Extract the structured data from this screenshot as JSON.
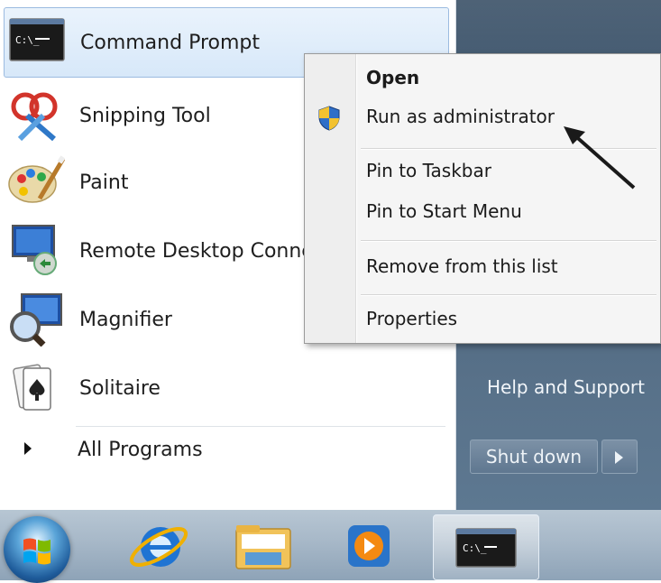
{
  "start_menu": {
    "programs": [
      {
        "label": "Command Prompt",
        "icon": "command-prompt-icon"
      },
      {
        "label": "Snipping Tool",
        "icon": "snipping-tool-icon"
      },
      {
        "label": "Paint",
        "icon": "paint-icon"
      },
      {
        "label": "Remote Desktop Conne",
        "icon": "remote-desktop-icon"
      },
      {
        "label": "Magnifier",
        "icon": "magnifier-icon"
      },
      {
        "label": "Solitaire",
        "icon": "solitaire-icon"
      }
    ],
    "all_programs": "All Programs",
    "right_pane": {
      "help_support": "Help and Support",
      "shutdown": "Shut down"
    }
  },
  "context_menu": {
    "items": [
      {
        "label": "Open"
      },
      {
        "label": "Run as administrator",
        "icon": "uac-shield-icon"
      },
      {
        "label": "Pin to Taskbar"
      },
      {
        "label": "Pin to Start Menu"
      },
      {
        "label": "Remove from this list"
      },
      {
        "label": "Properties"
      }
    ]
  },
  "taskbar": {
    "items": [
      "start-orb-icon",
      "internet-explorer-icon",
      "windows-explorer-icon",
      "media-player-icon",
      "command-prompt-icon"
    ]
  },
  "colors": {
    "right_pane": "#4b637c",
    "highlight": "#d7e8f9",
    "taskbar": "#a7b8c8"
  }
}
